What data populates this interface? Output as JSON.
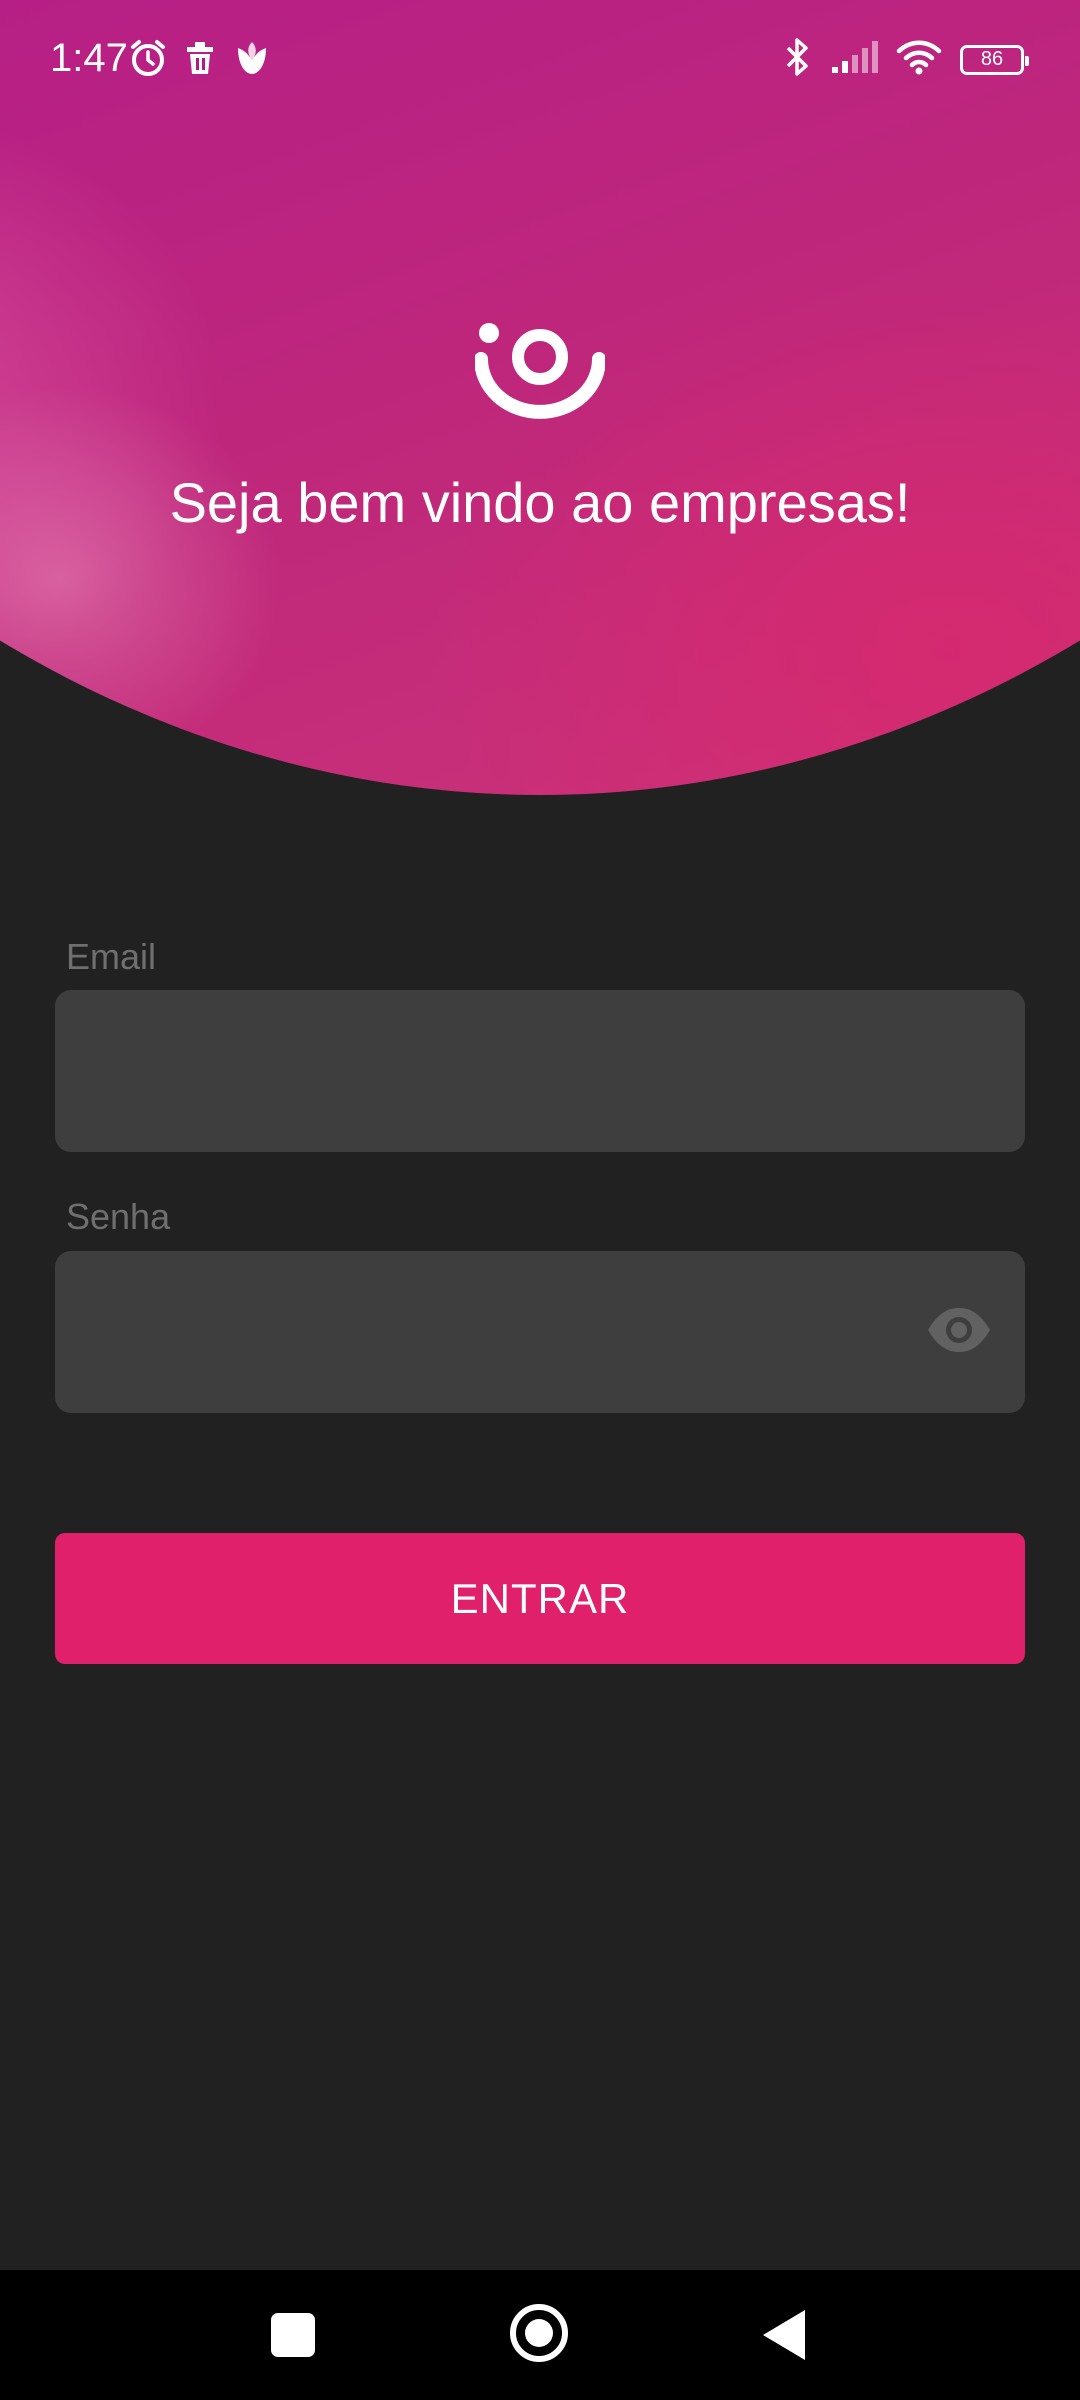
{
  "status_bar": {
    "time": "1:47",
    "battery": "86",
    "left_icons": [
      "alarm-icon",
      "trash-icon",
      "tulip-icon"
    ],
    "right_icons": [
      "bluetooth-icon",
      "signal-icon",
      "wifi-icon",
      "battery-icon"
    ]
  },
  "hero": {
    "logo_icon": "app-logo-icon",
    "welcome": "Seja bem vindo ao empresas!",
    "colors": {
      "primary": "#b11a8c",
      "accent": "#d82a6e"
    }
  },
  "form": {
    "email_label": "Email",
    "email_value": "",
    "password_label": "Senha",
    "password_value": "",
    "password_toggle_icon": "eye-icon",
    "submit_label": "ENTRAR",
    "submit_color": "#e0206a"
  },
  "nav_bar": {
    "buttons": [
      "recents-icon",
      "home-icon",
      "back-icon"
    ]
  }
}
